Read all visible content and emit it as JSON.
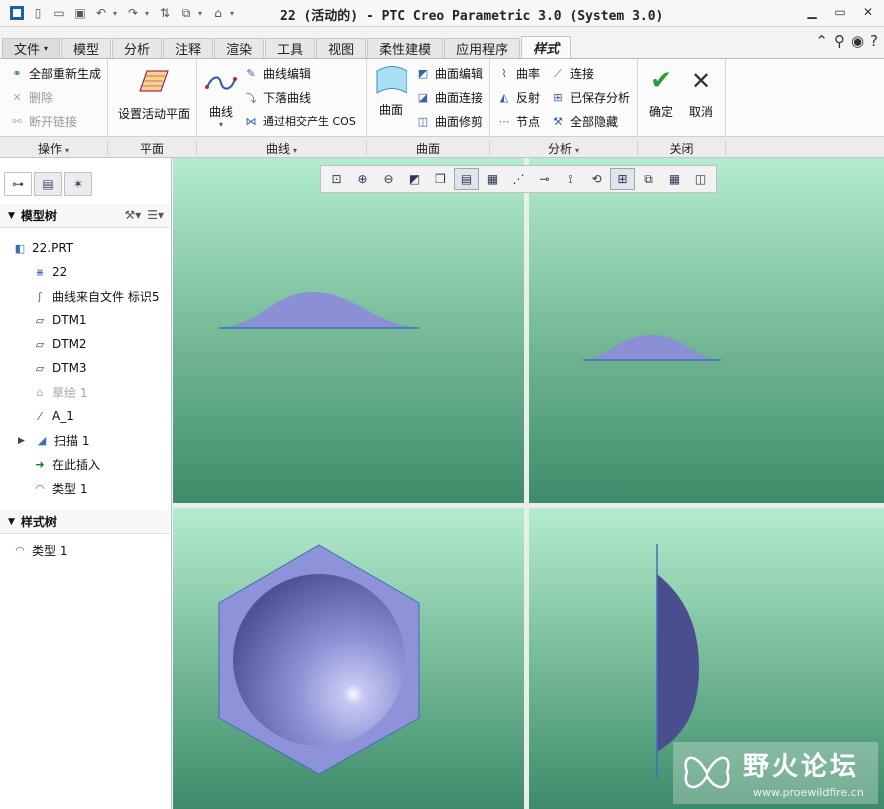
{
  "window": {
    "title": "22 (活动的) - PTC Creo Parametric 3.0 (System 3.0)"
  },
  "tabs": [
    {
      "label": "文件",
      "has_dropdown": true
    },
    {
      "label": "模型"
    },
    {
      "label": "分析"
    },
    {
      "label": "注释"
    },
    {
      "label": "渲染"
    },
    {
      "label": "工具"
    },
    {
      "label": "视图"
    },
    {
      "label": "柔性建模"
    },
    {
      "label": "应用程序"
    },
    {
      "label": "样式",
      "active": true
    }
  ],
  "ribbon": {
    "operations": {
      "regen_all": "全部重新生成",
      "delete": "删除",
      "break_link": "断开链接",
      "label": "操作"
    },
    "plane": {
      "set_active_plane": "设置活动平面",
      "label": "平面"
    },
    "curves": {
      "curve": "曲线",
      "curve_edit": "曲线编辑",
      "drop_curve": "下落曲线",
      "intersect_cos": "通过相交产生 COS",
      "label": "曲线"
    },
    "surfaces": {
      "surface": "曲面",
      "surface_edit": "曲面编辑",
      "surface_connect": "曲面连接",
      "surface_trim": "曲面修剪",
      "label": "曲面"
    },
    "analysis": {
      "curvature": "曲率",
      "connect": "连接",
      "reflect": "反射",
      "saved_analysis": "已保存分析",
      "nodes": "节点",
      "hide_all": "全部隐藏",
      "label": "分析"
    },
    "close": {
      "ok": "确定",
      "cancel": "取消",
      "label": "关闭"
    }
  },
  "model_tree": {
    "header": "模型树",
    "items": [
      {
        "label": "22.PRT",
        "icon": "part-icon"
      },
      {
        "label": "22",
        "icon": "csys-icon"
      },
      {
        "label": "曲线来自文件 标识5",
        "icon": "curve-file-icon"
      },
      {
        "label": "DTM1",
        "icon": "datum-plane-icon"
      },
      {
        "label": "DTM2",
        "icon": "datum-plane-icon"
      },
      {
        "label": "DTM3",
        "icon": "datum-plane-icon"
      },
      {
        "label": "草绘 1",
        "icon": "sketch-icon"
      },
      {
        "label": "A_1",
        "icon": "axis-icon"
      },
      {
        "label": "扫描 1",
        "icon": "sweep-icon"
      },
      {
        "label": "在此插入",
        "icon": "insert-arrow-icon"
      },
      {
        "label": "类型 1",
        "icon": "style-icon"
      }
    ]
  },
  "style_tree": {
    "header": "样式树",
    "items": [
      {
        "label": "类型 1",
        "icon": "style-icon"
      }
    ]
  },
  "watermark": {
    "name": "野火论坛",
    "url": "www.proewildfire.cn"
  },
  "colors": {
    "surface": "#8a8fd6",
    "vp_top": "#b4eccf",
    "vp_bottom": "#3d8b6a"
  }
}
